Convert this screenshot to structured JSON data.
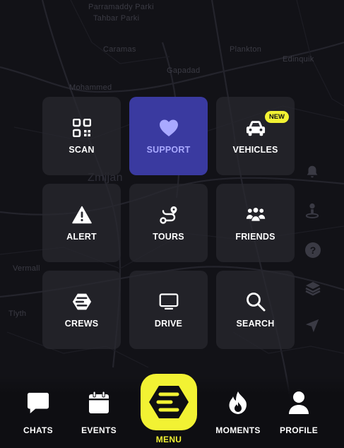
{
  "map": {
    "labels": [
      {
        "text": "Parramaddy Parki"
      },
      {
        "text": "Tahbar Parki"
      },
      {
        "text": "Caramas"
      },
      {
        "text": "Gapadad"
      },
      {
        "text": "Mohammed"
      },
      {
        "text": "Plankton"
      },
      {
        "text": "Zmijan"
      },
      {
        "text": "Tlyth"
      },
      {
        "text": "Vermall"
      },
      {
        "text": "Edinquik"
      }
    ]
  },
  "grid": {
    "tiles": [
      {
        "label": "SCAN",
        "icon": "qr-scan-icon",
        "active": false
      },
      {
        "label": "SUPPORT",
        "icon": "heart-icon",
        "active": true
      },
      {
        "label": "VEHICLES",
        "icon": "car-icon",
        "active": false,
        "badge": "NEW"
      },
      {
        "label": "ALERT",
        "icon": "warning-icon",
        "active": false
      },
      {
        "label": "TOURS",
        "icon": "route-icon",
        "active": false
      },
      {
        "label": "FRIENDS",
        "icon": "people-icon",
        "active": false
      },
      {
        "label": "CREWS",
        "icon": "crews-logo-icon",
        "active": false
      },
      {
        "label": "DRIVE",
        "icon": "monitor-icon",
        "active": false
      },
      {
        "label": "SEARCH",
        "icon": "search-icon",
        "active": false
      }
    ]
  },
  "nav": {
    "chats": "CHATS",
    "events": "EVENTS",
    "menu": "MENU",
    "moments": "MOMENTS",
    "profile": "PROFILE"
  },
  "colors": {
    "accent": "#f2f233",
    "active_tile": "#3a3aa0",
    "active_label": "#a9a9ff"
  }
}
